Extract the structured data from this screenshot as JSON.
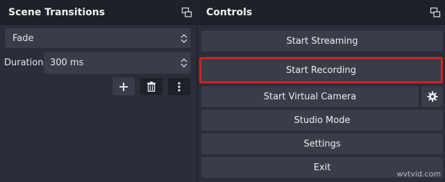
{
  "scene_transitions": {
    "title": "Scene Transitions",
    "transition_value": "Fade",
    "duration_label": "Duration",
    "duration_value": "300 ms"
  },
  "controls": {
    "title": "Controls",
    "start_streaming": "Start Streaming",
    "start_recording": "Start Recording",
    "start_virtual_camera": "Start Virtual Camera",
    "studio_mode": "Studio Mode",
    "settings": "Settings",
    "exit": "Exit"
  },
  "highlight_color": "#d42128",
  "icons": {
    "float": "float-icon",
    "add": "plus-icon",
    "delete": "trash-icon",
    "more": "more-vertical-icon",
    "gear": "gear-icon"
  },
  "watermark": "wvtvid.com"
}
